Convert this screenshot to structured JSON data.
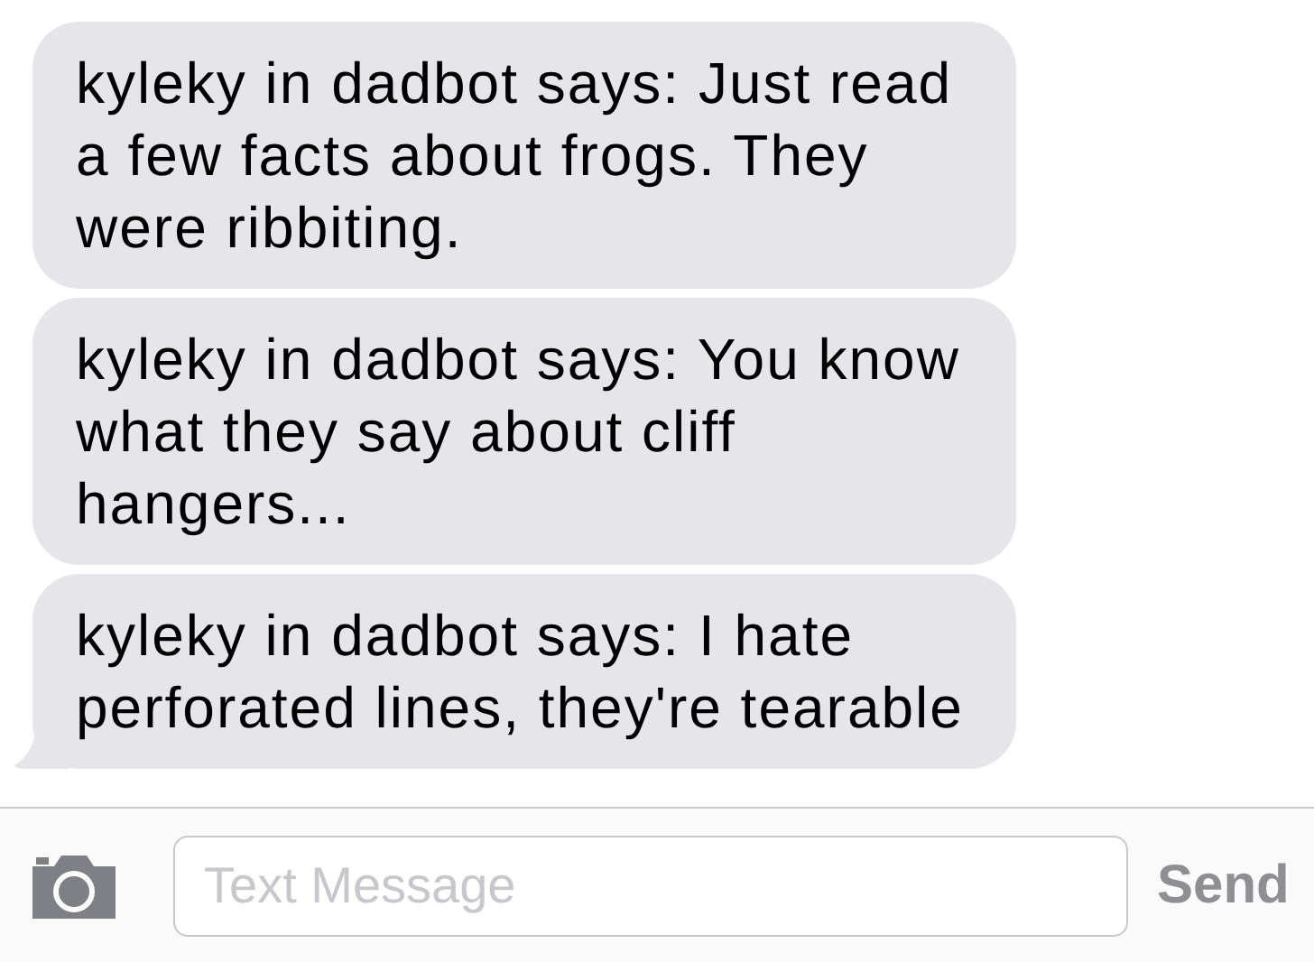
{
  "messages": [
    {
      "text": "kyleky in dadbot says: Just read a few facts about frogs. They were ribbiting.",
      "tail": false
    },
    {
      "text": "kyleky in dadbot says: You know what they say about cliff hangers...",
      "tail": false
    },
    {
      "text": "kyleky in dadbot says: I hate perforated lines, they're tearable",
      "tail": true
    }
  ],
  "composer": {
    "placeholder": "Text Message",
    "send": "Send"
  }
}
